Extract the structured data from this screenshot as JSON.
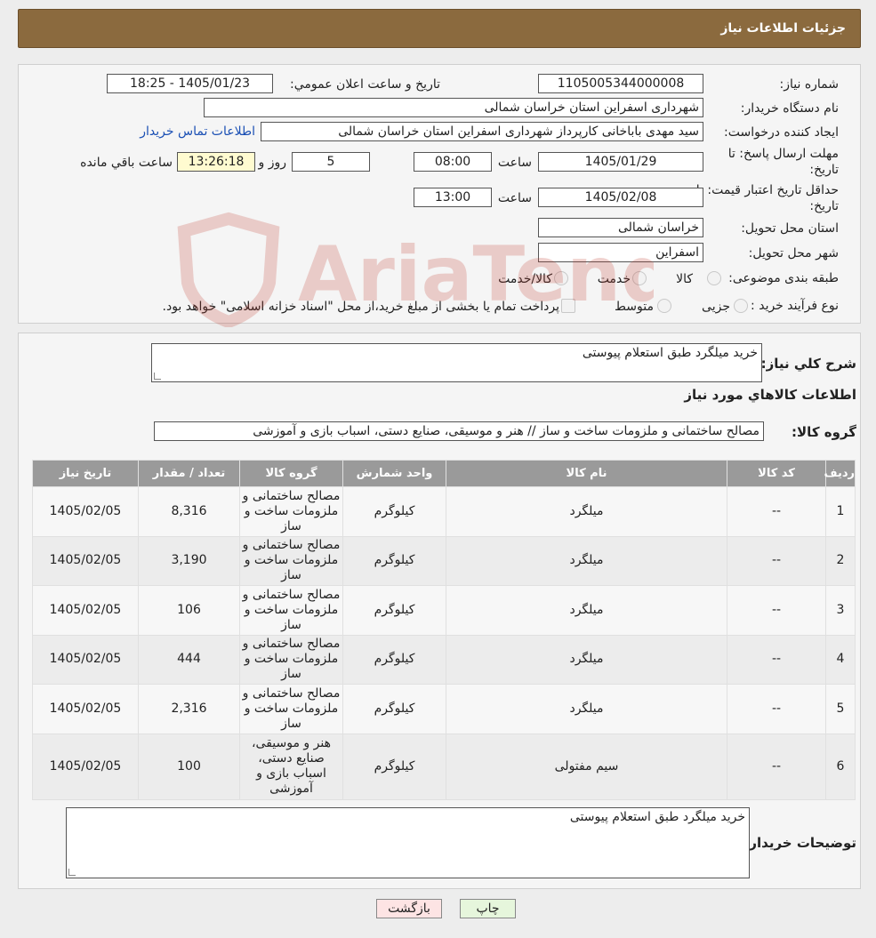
{
  "header": {
    "title": "جزئیات اطلاعات نیاز"
  },
  "details": {
    "need_number_label": "شماره نیاز:",
    "need_number": "1105005344000008",
    "announce_label": "تاریخ و ساعت اعلان عمومي:",
    "announce_value": "1405/01/23 - 18:25",
    "buyer_org_label": "نام دستگاه خريدار:",
    "buyer_org": "شهرداری اسفراین استان خراسان شمالی",
    "requester_label": "ایجاد کننده درخواست:",
    "requester": "سید مهدی  باباخانی کارپرداز   شهرداری اسفراین استان خراسان شمالی",
    "contact_link": "اطلاعات تماس خریدار",
    "reply_deadline_label_1": "مهلت ارسال پاسخ: تا",
    "reply_deadline_label_2": "تاریخ:",
    "reply_date": "1405/01/29",
    "time_label": "ساعت",
    "reply_time": "08:00",
    "days_value": "5",
    "days_label": "روز و",
    "remaining_time": "13:26:18",
    "remaining_label": "ساعت باقي مانده",
    "price_validity_label_1": "حداقل تاریخ اعتبار قیمت: تا",
    "price_validity_label_2": "تاریخ:",
    "price_date": "1405/02/08",
    "price_time": "13:00",
    "province_label": "استان محل تحویل:",
    "province": "خراسان شمالی",
    "city_label": "شهر محل تحویل:",
    "city": "اسفراین",
    "category_label": "طبقه بندی موضوعی:",
    "category_options": [
      "کالا",
      "خدمت",
      "کالا/خدمت"
    ],
    "process_label": "نوع فرآیند خرید :",
    "process_options": [
      "جزیی",
      "متوسط"
    ],
    "process_note": "پرداخت تمام یا بخشی از مبلغ خرید،از محل \"اسناد خزانه اسلامی\" خواهد بود."
  },
  "summary": {
    "general_label": "شرح کلي نياز:",
    "general_text": "خرید میلگرد طبق استعلام پیوستی",
    "items_title": "اطلاعات کالاهاي مورد نياز",
    "group_label": "گروه کالا:",
    "group_value": "مصالح ساختمانی و ملزومات ساخت و ساز // هنر و موسیقی، صنایع دستی، اسباب بازی و آموزشی"
  },
  "table": {
    "headers": [
      "رديف",
      "کد کالا",
      "نام کالا",
      "واحد شمارش",
      "گروه کالا",
      "تعداد / مقدار",
      "تاریخ نیاز"
    ],
    "rows": [
      [
        "1",
        "--",
        "میلگرد",
        "کیلوگرم",
        "مصالح ساختمانی و ملزومات ساخت و ساز",
        "8,316",
        "1405/02/05"
      ],
      [
        "2",
        "--",
        "میلگرد",
        "کیلوگرم",
        "مصالح ساختمانی و ملزومات ساخت و ساز",
        "3,190",
        "1405/02/05"
      ],
      [
        "3",
        "--",
        "میلگرد",
        "کیلوگرم",
        "مصالح ساختمانی و ملزومات ساخت و ساز",
        "106",
        "1405/02/05"
      ],
      [
        "4",
        "--",
        "میلگرد",
        "کیلوگرم",
        "مصالح ساختمانی و ملزومات ساخت و ساز",
        "444",
        "1405/02/05"
      ],
      [
        "5",
        "--",
        "میلگرد",
        "کیلوگرم",
        "مصالح ساختمانی و ملزومات ساخت و ساز",
        "2,316",
        "1405/02/05"
      ],
      [
        "6",
        "--",
        "سیم مفتولی",
        "کیلوگرم",
        "هنر و موسیقی، صنایع دستی، اسباب بازی و آموزشی",
        "100",
        "1405/02/05"
      ]
    ]
  },
  "buyer_notes": {
    "label": "توضیحات خریدار:",
    "text": "خرید میلگرد طبق استعلام پیوستی"
  },
  "buttons": {
    "print": "چاپ",
    "back": "بازگشت"
  },
  "watermark": {
    "text": "AriaTender.neT"
  },
  "colors": {
    "header": "#8b6a3e",
    "table_header": "#9a9a9a",
    "link": "#1a4fb4",
    "back_button": "#fde4e4",
    "print_button": "#e6f6dc"
  }
}
